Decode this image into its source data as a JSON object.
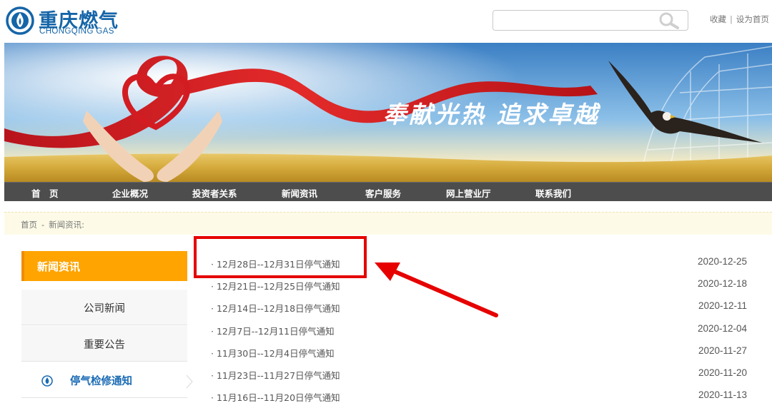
{
  "header": {
    "logo_cn": "重庆燃气",
    "logo_en": "CHONGQING GAS",
    "search_value": "",
    "links": [
      "收藏",
      "设为首页"
    ],
    "link_separator": "|"
  },
  "banner": {
    "slogan": "奉献光热 追求卓越"
  },
  "nav": {
    "items": [
      "首　页",
      "企业概况",
      "投资者关系",
      "新闻资讯",
      "客户服务",
      "网上营业厅",
      "联系我们"
    ]
  },
  "breadcrumb": {
    "home": "首页",
    "separator": "-",
    "current": "新闻资讯:"
  },
  "sidebar": {
    "title": "新闻资讯",
    "items": [
      {
        "label": "公司新闻"
      },
      {
        "label": "重要公告"
      },
      {
        "label": "停气检修通知",
        "active": true
      }
    ]
  },
  "news": {
    "items": [
      {
        "title": "· 12月28日--12月31日停气通知",
        "date": "2020-12-25"
      },
      {
        "title": "· 12月21日--12月25日停气通知",
        "date": "2020-12-18"
      },
      {
        "title": "· 12月14日--12月18日停气通知",
        "date": "2020-12-11"
      },
      {
        "title": "· 12月7日--12月11日停气通知",
        "date": "2020-12-04"
      },
      {
        "title": "· 11月30日--12月4日停气通知",
        "date": "2020-11-27"
      },
      {
        "title": "· 11月23日--11月27日停气通知",
        "date": "2020-11-20"
      },
      {
        "title": "· 11月16日--11月20日停气通知",
        "date": "2020-11-13"
      }
    ]
  },
  "colors": {
    "brand_blue": "#1565a8",
    "nav_bg": "#4d4d4d",
    "sidebar_title_bg": "#ffa400",
    "active_item_text": "#1b6bb4",
    "annotation_red": "#e60000"
  }
}
